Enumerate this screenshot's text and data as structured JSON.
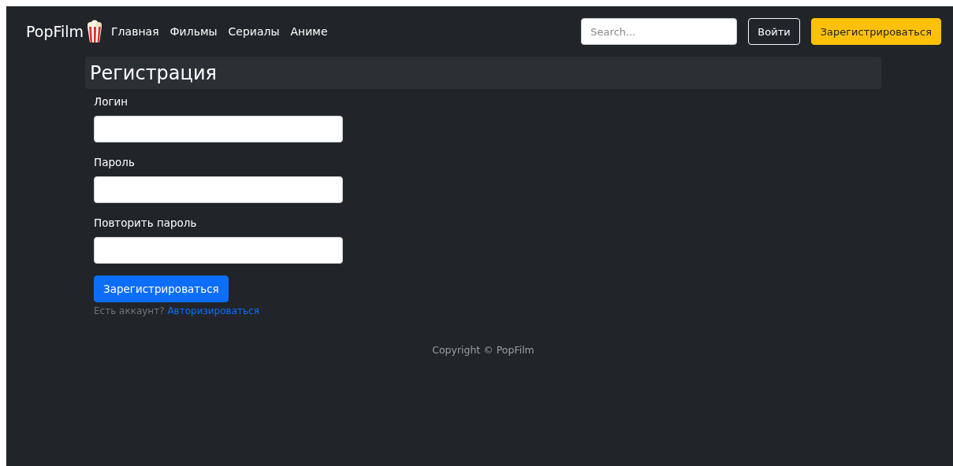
{
  "navbar": {
    "brand": "PopFilm",
    "links": [
      "Главная",
      "Фильмы",
      "Сериалы",
      "Аниме"
    ],
    "search": {
      "placeholder": "Search..."
    },
    "login_button": "Войти",
    "register_button": "Зарегистрироваться"
  },
  "page_title": "Регистрация",
  "form": {
    "fields": [
      {
        "label": "Логин"
      },
      {
        "label": "Пароль"
      },
      {
        "label": "Повторить пароль"
      }
    ],
    "submit": "Зарегистрироваться",
    "account_prompt": {
      "text": "Есть аккаунт?",
      "link": "Авторизироваться"
    }
  },
  "footer": "Copyright © PopFilm"
}
